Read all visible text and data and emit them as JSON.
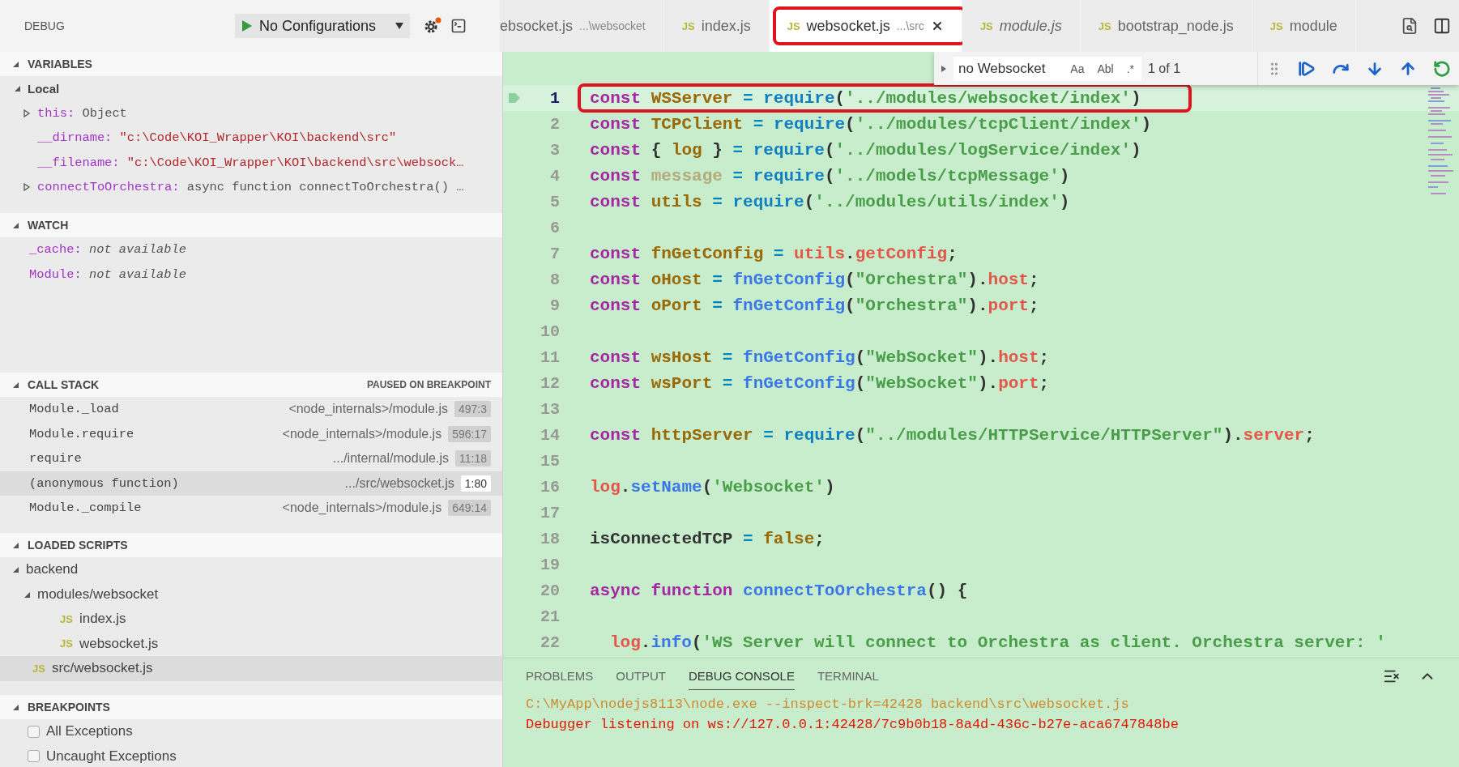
{
  "sidebar": {
    "title": "DEBUG",
    "configuration": "No Configurations"
  },
  "tabs": [
    {
      "label": "ebsocket.js",
      "description": "...\\websocket",
      "selected": false,
      "preview": false
    },
    {
      "badge": "JS",
      "label": "index.js",
      "selected": false,
      "preview": false
    },
    {
      "badge": "JS",
      "label": "websocket.js",
      "description": "...\\src",
      "selected": true,
      "preview": false
    },
    {
      "badge": "JS",
      "label": "module.js",
      "selected": false,
      "preview": true
    },
    {
      "badge": "JS",
      "label": "bootstrap_node.js",
      "selected": false,
      "preview": false
    },
    {
      "badge": "JS",
      "label": "module",
      "selected": false,
      "preview": false
    }
  ],
  "find": {
    "value": "no Websocket",
    "options": [
      {
        "label": "Aa",
        "on": false
      },
      {
        "label": "Abl",
        "on": false
      },
      {
        "label": ".*",
        "on": false
      }
    ],
    "count": "1 of 1"
  },
  "variables": {
    "title": "VARIABLES",
    "scopes": [
      {
        "label": "Local",
        "expanded": true,
        "items": [
          {
            "name": "this:",
            "value": "Object",
            "kind": "object",
            "expandable": true
          },
          {
            "name": "__dirname:",
            "value": "\"c:\\Code\\KOI_Wrapper\\KOI\\backend\\src\"",
            "kind": "string",
            "expandable": false
          },
          {
            "name": "__filename:",
            "value": "\"c:\\Code\\KOI_Wrapper\\KOI\\backend\\src\\websock…",
            "kind": "string",
            "expandable": false
          },
          {
            "name": "connectToOrchestra:",
            "value": "async function connectToOrchestra() …",
            "kind": "function",
            "expandable": true
          }
        ]
      }
    ]
  },
  "watch": {
    "title": "WATCH",
    "items": [
      {
        "name": "_cache:",
        "value": "not available"
      },
      {
        "name": "Module:",
        "value": "not available"
      }
    ]
  },
  "call_stack": {
    "title": "CALL STACK",
    "status": "PAUSED ON BREAKPOINT",
    "frames": [
      {
        "name": "Module._load",
        "source": "<node_internals>/module.js",
        "position": "497:3",
        "selected": false
      },
      {
        "name": "Module.require",
        "source": "<node_internals>/module.js",
        "position": "596:17",
        "selected": false
      },
      {
        "name": "require",
        "source": ".../internal/module.js",
        "position": "11:18",
        "selected": false
      },
      {
        "name": "(anonymous function)",
        "source": ".../src/websocket.js",
        "position": "1:80",
        "selected": true
      },
      {
        "name": "Module._compile",
        "source": "<node_internals>/module.js",
        "position": "649:14",
        "selected": false
      }
    ]
  },
  "loaded_scripts": {
    "title": "LOADED SCRIPTS",
    "tree": [
      {
        "label": "backend",
        "expanded": true,
        "selected": false,
        "children": [
          {
            "label": "modules/websocket",
            "expanded": true,
            "selected": false,
            "children": [
              {
                "label": "index.js",
                "badge": "JS",
                "selected": false
              },
              {
                "label": "websocket.js",
                "badge": "JS",
                "selected": false
              }
            ]
          },
          {
            "label": "src/websocket.js",
            "badge": "JS",
            "selected": true
          }
        ]
      }
    ]
  },
  "breakpoints": {
    "title": "BREAKPOINTS",
    "items": [
      {
        "label": "All Exceptions",
        "checked": false
      },
      {
        "label": "Uncaught Exceptions",
        "checked": false
      }
    ]
  },
  "editor": {
    "lines": [
      {
        "n": "1",
        "current": true,
        "tokens": [
          {
            "kind": "kw",
            "text": "const "
          },
          {
            "kind": "def",
            "text": "WSServer "
          },
          {
            "kind": "op",
            "text": "= "
          },
          {
            "kind": "req",
            "text": "require"
          },
          {
            "kind": "plain",
            "text": "("
          },
          {
            "kind": "str",
            "text": "'../modules/websocket/index'"
          },
          {
            "kind": "plain",
            "text": ")"
          }
        ]
      },
      {
        "n": "2",
        "current": false,
        "tokens": [
          {
            "kind": "kw",
            "text": "const "
          },
          {
            "kind": "def",
            "text": "TCPClient "
          },
          {
            "kind": "op",
            "text": "= "
          },
          {
            "kind": "req",
            "text": "require"
          },
          {
            "kind": "plain",
            "text": "("
          },
          {
            "kind": "str",
            "text": "'../modules/tcpClient/index'"
          },
          {
            "kind": "plain",
            "text": ")"
          }
        ]
      },
      {
        "n": "3",
        "current": false,
        "tokens": [
          {
            "kind": "kw",
            "text": "const "
          },
          {
            "kind": "plain",
            "text": "{ "
          },
          {
            "kind": "def",
            "text": "log "
          },
          {
            "kind": "plain",
            "text": "} "
          },
          {
            "kind": "op",
            "text": "= "
          },
          {
            "kind": "req",
            "text": "require"
          },
          {
            "kind": "plain",
            "text": "("
          },
          {
            "kind": "str",
            "text": "'../modules/logService/index'"
          },
          {
            "kind": "plain",
            "text": ")"
          }
        ]
      },
      {
        "n": "4",
        "current": false,
        "tokens": [
          {
            "kind": "kw",
            "text": "const "
          },
          {
            "kind": "dim",
            "text": "message "
          },
          {
            "kind": "op",
            "text": "= "
          },
          {
            "kind": "req",
            "text": "require"
          },
          {
            "kind": "plain",
            "text": "("
          },
          {
            "kind": "str",
            "text": "'../models/tcpMessage'"
          },
          {
            "kind": "plain",
            "text": ")"
          }
        ]
      },
      {
        "n": "5",
        "current": false,
        "tokens": [
          {
            "kind": "kw",
            "text": "const "
          },
          {
            "kind": "def",
            "text": "utils "
          },
          {
            "kind": "op",
            "text": "= "
          },
          {
            "kind": "req",
            "text": "require"
          },
          {
            "kind": "plain",
            "text": "("
          },
          {
            "kind": "str",
            "text": "'../modules/utils/index'"
          },
          {
            "kind": "plain",
            "text": ")"
          }
        ]
      },
      {
        "n": "6",
        "current": false
      },
      {
        "n": "7",
        "current": false,
        "tokens": [
          {
            "kind": "kw",
            "text": "const "
          },
          {
            "kind": "def",
            "text": "fnGetConfig "
          },
          {
            "kind": "op",
            "text": "= "
          },
          {
            "kind": "prop",
            "text": "utils"
          },
          {
            "kind": "plain",
            "text": "."
          },
          {
            "kind": "prop",
            "text": "getConfig"
          },
          {
            "kind": "plain",
            "text": ";"
          }
        ]
      },
      {
        "n": "8",
        "current": false,
        "tokens": [
          {
            "kind": "kw",
            "text": "const "
          },
          {
            "kind": "def",
            "text": "oHost "
          },
          {
            "kind": "op",
            "text": "= "
          },
          {
            "kind": "fn",
            "text": "fnGetConfig"
          },
          {
            "kind": "plain",
            "text": "("
          },
          {
            "kind": "str",
            "text": "\"Orchestra\""
          },
          {
            "kind": "plain",
            "text": ")."
          },
          {
            "kind": "prop",
            "text": "host"
          },
          {
            "kind": "plain",
            "text": ";"
          }
        ]
      },
      {
        "n": "9",
        "current": false,
        "tokens": [
          {
            "kind": "kw",
            "text": "const "
          },
          {
            "kind": "def",
            "text": "oPort "
          },
          {
            "kind": "op",
            "text": "= "
          },
          {
            "kind": "fn",
            "text": "fnGetConfig"
          },
          {
            "kind": "plain",
            "text": "("
          },
          {
            "kind": "str",
            "text": "\"Orchestra\""
          },
          {
            "kind": "plain",
            "text": ")."
          },
          {
            "kind": "prop",
            "text": "port"
          },
          {
            "kind": "plain",
            "text": ";"
          }
        ]
      },
      {
        "n": "10",
        "current": false
      },
      {
        "n": "11",
        "current": false,
        "tokens": [
          {
            "kind": "kw",
            "text": "const "
          },
          {
            "kind": "def",
            "text": "wsHost "
          },
          {
            "kind": "op",
            "text": "= "
          },
          {
            "kind": "fn",
            "text": "fnGetConfig"
          },
          {
            "kind": "plain",
            "text": "("
          },
          {
            "kind": "str",
            "text": "\"WebSocket\""
          },
          {
            "kind": "plain",
            "text": ")."
          },
          {
            "kind": "prop",
            "text": "host"
          },
          {
            "kind": "plain",
            "text": ";"
          }
        ]
      },
      {
        "n": "12",
        "current": false,
        "tokens": [
          {
            "kind": "kw",
            "text": "const "
          },
          {
            "kind": "def",
            "text": "wsPort "
          },
          {
            "kind": "op",
            "text": "= "
          },
          {
            "kind": "fn",
            "text": "fnGetConfig"
          },
          {
            "kind": "plain",
            "text": "("
          },
          {
            "kind": "str",
            "text": "\"WebSocket\""
          },
          {
            "kind": "plain",
            "text": ")."
          },
          {
            "kind": "prop",
            "text": "port"
          },
          {
            "kind": "plain",
            "text": ";"
          }
        ]
      },
      {
        "n": "13",
        "current": false
      },
      {
        "n": "14",
        "current": false,
        "tokens": [
          {
            "kind": "kw",
            "text": "const "
          },
          {
            "kind": "def",
            "text": "httpServer "
          },
          {
            "kind": "op",
            "text": "= "
          },
          {
            "kind": "req",
            "text": "require"
          },
          {
            "kind": "plain",
            "text": "("
          },
          {
            "kind": "str",
            "text": "\"../modules/HTTPService/HTTPServer\""
          },
          {
            "kind": "plain",
            "text": ")."
          },
          {
            "kind": "prop",
            "text": "server"
          },
          {
            "kind": "plain",
            "text": ";"
          }
        ]
      },
      {
        "n": "15",
        "current": false
      },
      {
        "n": "16",
        "current": false,
        "tokens": [
          {
            "kind": "prop",
            "text": "log"
          },
          {
            "kind": "plain",
            "text": "."
          },
          {
            "kind": "fn",
            "text": "setName"
          },
          {
            "kind": "plain",
            "text": "("
          },
          {
            "kind": "str",
            "text": "'Websocket'"
          },
          {
            "kind": "plain",
            "text": ")"
          }
        ]
      },
      {
        "n": "17",
        "current": false
      },
      {
        "n": "18",
        "current": false,
        "tokens": [
          {
            "kind": "plain",
            "text": "isConnectedTCP "
          },
          {
            "kind": "op",
            "text": "= "
          },
          {
            "kind": "def",
            "text": "false"
          },
          {
            "kind": "plain",
            "text": ";"
          }
        ]
      },
      {
        "n": "19",
        "current": false
      },
      {
        "n": "20",
        "current": false,
        "tokens": [
          {
            "kind": "kw",
            "text": "async function "
          },
          {
            "kind": "fn",
            "text": "connectToOrchestra"
          },
          {
            "kind": "plain",
            "text": "() {"
          }
        ]
      },
      {
        "n": "21",
        "current": false
      },
      {
        "n": "22",
        "current": false,
        "indented": true,
        "tokens": [
          {
            "kind": "prop",
            "text": "log"
          },
          {
            "kind": "plain",
            "text": "."
          },
          {
            "kind": "fn",
            "text": "info"
          },
          {
            "kind": "plain",
            "text": "("
          },
          {
            "kind": "str",
            "text": "'WS Server will connect to Orchestra as client. Orchestra server: '"
          }
        ]
      }
    ]
  },
  "panel": {
    "tabs": [
      {
        "label": "PROBLEMS",
        "selected": false
      },
      {
        "label": "OUTPUT",
        "selected": false
      },
      {
        "label": "DEBUG CONSOLE",
        "selected": true
      },
      {
        "label": "TERMINAL",
        "selected": false
      }
    ],
    "output": [
      {
        "kind": "command",
        "text": "C:\\MyApp\\nodejs8113\\node.exe --inspect-brk=42428 backend\\src\\websocket.js"
      },
      {
        "kind": "error",
        "text": "Debugger listening on ws://127.0.0.1:42428/7c9b0b18-8a4d-436c-b27e-aca6747848be"
      }
    ]
  }
}
